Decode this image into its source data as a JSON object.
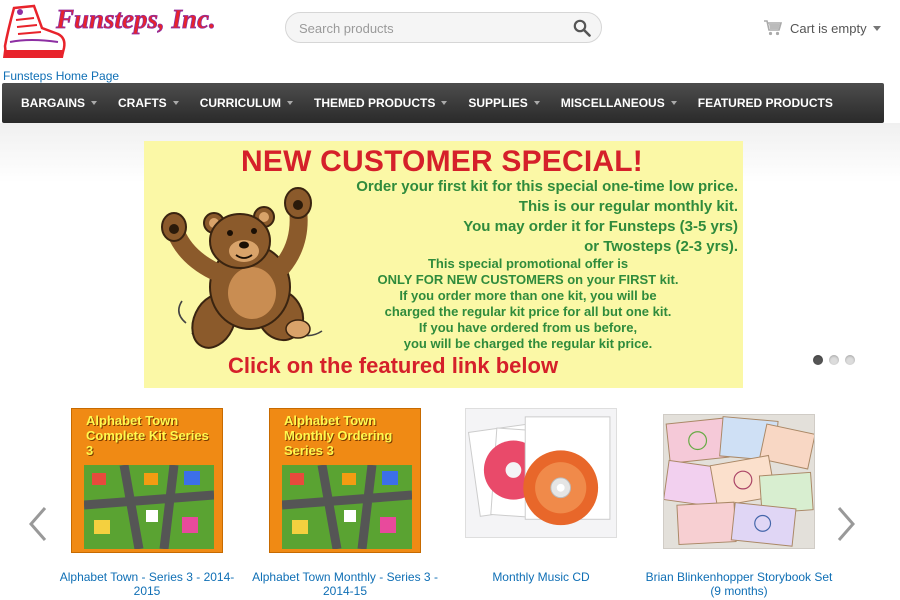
{
  "header": {
    "logo_text": "Funsteps, Inc.",
    "home_link": "Funsteps Home Page",
    "search_placeholder": "Search products",
    "cart_label": "Cart is empty"
  },
  "nav": {
    "items": [
      {
        "label": "BARGAINS",
        "has_dropdown": true
      },
      {
        "label": "CRAFTS",
        "has_dropdown": true
      },
      {
        "label": "CURRICULUM",
        "has_dropdown": true
      },
      {
        "label": "THEMED PRODUCTS",
        "has_dropdown": true
      },
      {
        "label": "SUPPLIES",
        "has_dropdown": true
      },
      {
        "label": "MISCELLANEOUS",
        "has_dropdown": true
      },
      {
        "label": "FEATURED PRODUCTS",
        "has_dropdown": false
      }
    ]
  },
  "banner": {
    "title": "NEW CUSTOMER SPECIAL!",
    "lines1": [
      "Order your first kit for this special one-time low price.",
      "This is our regular monthly kit.",
      "You may order it for Funsteps (3-5 yrs)",
      "or Twosteps (2-3 yrs)."
    ],
    "lines2": [
      "This special promotional offer is",
      "ONLY FOR NEW CUSTOMERS on your FIRST kit.",
      "If you order more than one kit, you will be",
      "charged the regular kit price for all but one kit.",
      "If you have ordered from us before,",
      "you will be charged the regular kit price."
    ],
    "cta": "Click on the featured link below",
    "slides": 3,
    "active_slide": 1
  },
  "products": [
    {
      "name": "Alphabet Town - Series 3 - 2014-2015",
      "thumb_title": "Alphabet Town Complete Kit Series 3"
    },
    {
      "name": "Alphabet Town Monthly - Series 3 - 2014-15",
      "thumb_title": "Alphabet Town Monthly Ordering Series 3"
    },
    {
      "name": "Monthly Music CD"
    },
    {
      "name": "Brian Blinkenhopper Storybook Set (9 months)"
    }
  ],
  "colors": {
    "nav_bg": "#3a3a3a",
    "link": "#0f6fb5",
    "banner_bg": "#fbf8a6",
    "banner_red": "#d5202a",
    "banner_green": "#2f8b3c",
    "logo_red": "#e8232b",
    "logo_purple": "#8d2fa3"
  },
  "icons": {
    "search": "magnifier-icon",
    "cart": "cart-icon",
    "prev": "chevron-left-icon",
    "next": "chevron-right-icon"
  }
}
